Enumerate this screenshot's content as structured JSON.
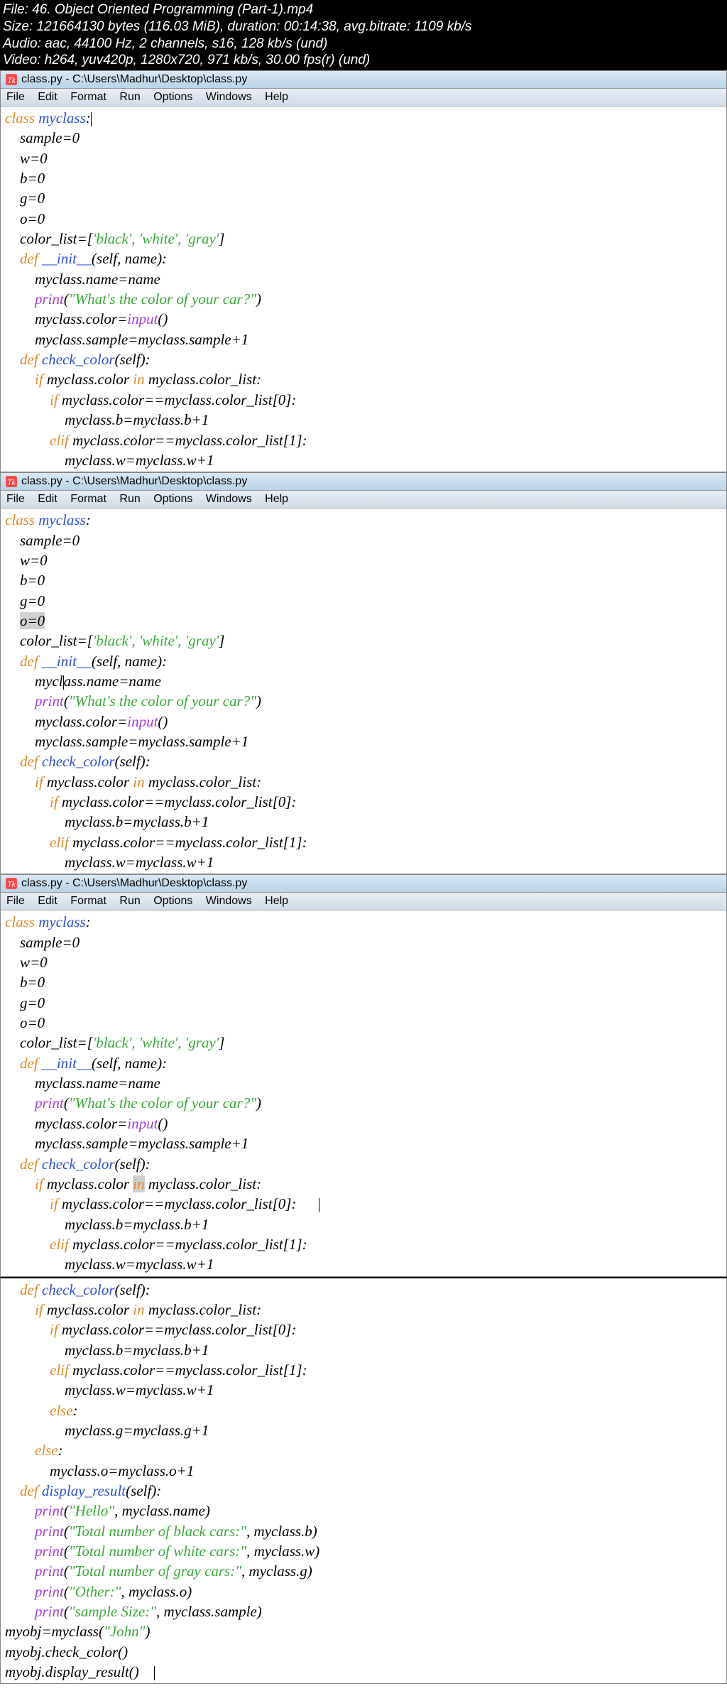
{
  "info": {
    "line1": "File: 46. Object Oriented Programming (Part-1).mp4",
    "line2": "Size: 121664130 bytes (116.03 MiB), duration: 00:14:38, avg.bitrate: 1109 kb/s",
    "line3": "Audio: aac, 44100 Hz, 2 channels, s16, 128 kb/s (und)",
    "line4": "Video: h264, yuv420p, 1280x720, 971 kb/s, 30.00 fps(r) (und)"
  },
  "window_title": "class.py - C:\\Users\\Madhur\\Desktop\\class.py",
  "menu": {
    "file": "File",
    "edit": "Edit",
    "format": "Format",
    "run": "Run",
    "options": "Options",
    "windows": "Windows",
    "help": "Help"
  },
  "timestamps": {
    "p1": "",
    "p2": "",
    "p3": "",
    "p4": ""
  },
  "code": {
    "class_kw": "class",
    "class_name": "myclass",
    "sample_line": "sample=0",
    "w_line": "w=0",
    "b_line": "b=0",
    "g_line": "g=0",
    "o_line": "o=0",
    "color_list_pre": "color_list=[",
    "color_list_str": "'black', 'white', 'gray'",
    "color_list_post": "]",
    "def_kw": "def",
    "init_name": "__init__",
    "init_args": "(self, name):",
    "name_assign": "myclass.name=name",
    "print_fn": "print",
    "print_str1": "\"What's the color of your car?\"",
    "color_input_pre": "myclass.color=",
    "input_fn": "input",
    "input_post": "()",
    "sample_inc": "myclass.sample=myclass.sample+1",
    "check_color_name": "check_color",
    "check_color_args": "(self):",
    "if_kw": "if",
    "elif_kw": "elif",
    "else_kw": "else",
    "in_kw": "in",
    "color_in_pre": "myclass.color ",
    "color_in_post": " myclass.color_list:",
    "cond0": "myclass.color==myclass.color_list[0]:",
    "b_inc": "myclass.b=myclass.b+1",
    "cond1": "myclass.color==myclass.color_list[1]:",
    "w_inc": "myclass.w=myclass.w+1",
    "g_inc": "myclass.g=myclass.g+1",
    "o_inc": "myclass.o=myclass.o+1",
    "display_name": "display_result",
    "display_args": "(self):",
    "hello_str": "\"Hello\"",
    "hello_post": ", myclass.name)",
    "black_str": "\"Total number of black cars:\"",
    "black_post": ", myclass.b)",
    "white_str": "\"Total number of white cars:\"",
    "white_post": ", myclass.w)",
    "gray_str": "\"Total number of gray cars:\"",
    "gray_post": ", myclass.g)",
    "other_str": "\"Other:\"",
    "other_post": ", myclass.o)",
    "sample_str": "\"sample Size:\"",
    "sample_post": ", myclass.sample)",
    "myobj_assign_pre": "myobj=myclass(",
    "john_str": "\"John\"",
    "myobj_assign_post": ")",
    "myobj_check": "myobj.check_color()",
    "myobj_display": "myobj.display_result()"
  }
}
